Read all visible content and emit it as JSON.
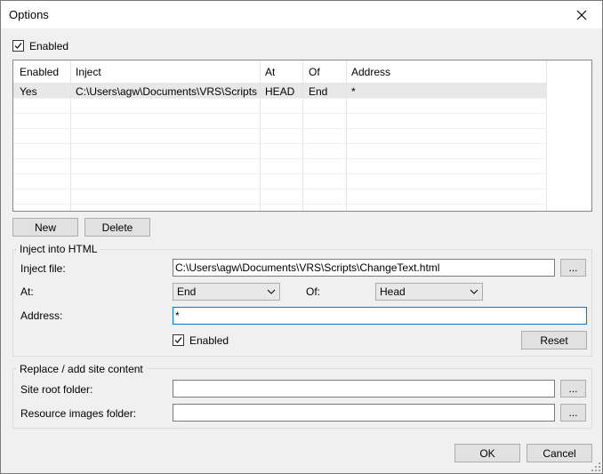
{
  "window": {
    "title": "Options"
  },
  "enabled_top": {
    "label": "Enabled",
    "checked": true
  },
  "table": {
    "columns": [
      "Enabled",
      "Inject",
      "At",
      "Of",
      "Address"
    ],
    "rows": [
      [
        "Yes",
        "C:\\Users\\agw\\Documents\\VRS\\Scripts...",
        "HEAD",
        "End",
        "*"
      ]
    ]
  },
  "table_buttons": {
    "new": "New",
    "delete": "Delete"
  },
  "inject_group": {
    "title": "Inject into HTML",
    "inject_file_label": "Inject file:",
    "inject_file_value": "C:\\Users\\agw\\Documents\\VRS\\Scripts\\ChangeText.html",
    "browse": "...",
    "at_label": "At:",
    "at_value": "End",
    "of_label": "Of:",
    "of_value": "Head",
    "address_label": "Address:",
    "address_value": "*",
    "enabled_label": "Enabled",
    "reset": "Reset"
  },
  "site_group": {
    "title": "Replace / add site content",
    "site_root_label": "Site root folder:",
    "site_root_value": "",
    "resource_label": "Resource images folder:",
    "resource_value": "",
    "browse": "..."
  },
  "dialog_buttons": {
    "ok": "OK",
    "cancel": "Cancel"
  }
}
